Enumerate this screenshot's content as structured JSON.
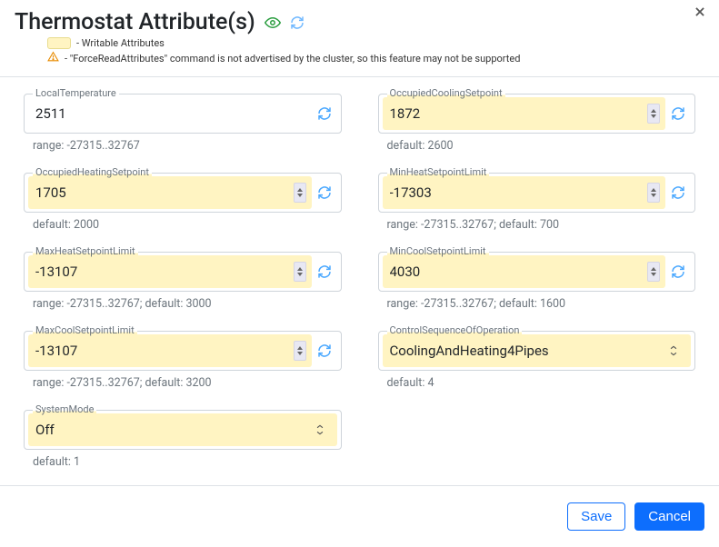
{
  "header": {
    "title": "Thermostat Attribute(s)",
    "legend_writable": "- Writable Attributes",
    "legend_warning": "- \"ForceReadAttributes\" command is not advertised by the cluster, so this feature may not be supported"
  },
  "fields": {
    "localTemperature": {
      "label": "LocalTemperature",
      "value": "2511",
      "hint": "range: -27315..32767"
    },
    "occupiedCoolingSetpoint": {
      "label": "OccupiedCoolingSetpoint",
      "value": "1872",
      "hint": "default: 2600"
    },
    "occupiedHeatingSetpoint": {
      "label": "OccupiedHeatingSetpoint",
      "value": "1705",
      "hint": "default: 2000"
    },
    "minHeatSetpointLimit": {
      "label": "MinHeatSetpointLimit",
      "value": "-17303",
      "hint": "range: -27315..32767; default: 700"
    },
    "maxHeatSetpointLimit": {
      "label": "MaxHeatSetpointLimit",
      "value": "-13107",
      "hint": "range: -27315..32767; default: 3000"
    },
    "minCoolSetpointLimit": {
      "label": "MinCoolSetpointLimit",
      "value": "4030",
      "hint": "range: -27315..32767; default: 1600"
    },
    "maxCoolSetpointLimit": {
      "label": "MaxCoolSetpointLimit",
      "value": "-13107",
      "hint": "range: -27315..32767; default: 3200"
    },
    "controlSequenceOfOperation": {
      "label": "ControlSequenceOfOperation",
      "value": "CoolingAndHeating4Pipes",
      "hint": "default: 4"
    },
    "systemMode": {
      "label": "SystemMode",
      "value": "Off",
      "hint": "default: 1"
    }
  },
  "footer": {
    "save": "Save",
    "cancel": "Cancel"
  },
  "colors": {
    "writable_bg": "#fff4c2",
    "primary": "#0d6efd"
  }
}
